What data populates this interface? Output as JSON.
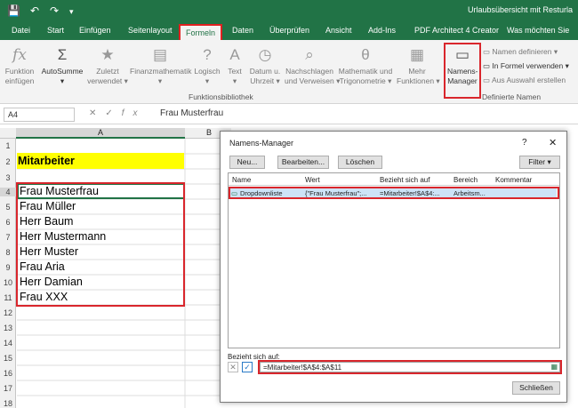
{
  "app": {
    "title": "Urlaubsübersicht mit Resturla",
    "qat": {
      "save": "💾",
      "undo": "↶",
      "redo": "↷",
      "customize": "▾"
    }
  },
  "tabs": [
    "Datei",
    "Start",
    "Einfügen",
    "Seitenlayout",
    "Formeln",
    "Daten",
    "Überprüfen",
    "Ansicht",
    "Add-Ins",
    "PDF Architect 4 Creator",
    "Was möchten Sie"
  ],
  "ribbon": {
    "buttons": [
      {
        "l1": "Funktion",
        "l2": "einfügen"
      },
      {
        "l1": "AutoSumme",
        "l2": "▾"
      },
      {
        "l1": "Zuletzt",
        "l2": "verwendet ▾"
      },
      {
        "l1": "Finanzmathematik",
        "l2": "▾"
      },
      {
        "l1": "Logisch",
        "l2": "▾"
      },
      {
        "l1": "Text",
        "l2": "▾"
      },
      {
        "l1": "Datum u.",
        "l2": "Uhrzeit ▾"
      },
      {
        "l1": "Nachschlagen",
        "l2": "und Verweisen ▾"
      },
      {
        "l1": "Mathematik und",
        "l2": "Trigonometrie ▾"
      },
      {
        "l1": "Mehr",
        "l2": "Funktionen ▾"
      },
      {
        "l1": "Namens-",
        "l2": "Manager"
      }
    ],
    "group_function_library": "Funktionsbibliothek",
    "names_menu": [
      "Namen definieren ▾",
      "In Formel verwenden ▾",
      "Aus Auswahl erstellen"
    ],
    "group_defined_names": "Definierte Namen"
  },
  "formula_bar": {
    "name_box": "A4",
    "cancel": "✕",
    "confirm": "✓",
    "fx": "fx",
    "content": "Frau Musterfrau"
  },
  "columns": [
    "A",
    "B"
  ],
  "rows": [
    "1",
    "2",
    "3",
    "4",
    "5",
    "6",
    "7",
    "8",
    "9",
    "10",
    "11",
    "12",
    "13",
    "14",
    "15",
    "16",
    "17",
    "18"
  ],
  "cells": {
    "a2": "Mitarbeiter",
    "a4": "Frau Musterfrau",
    "a5": "Frau Müller",
    "a6": "Herr Baum",
    "a7": "Herr Mustermann",
    "a8": "Herr Muster",
    "a9": "Frau Aria",
    "a10": "Herr Damian",
    "a11": "Frau XXX"
  },
  "dialog": {
    "title": "Namens-Manager",
    "help": "?",
    "close": "✕",
    "buttons": {
      "new": "Neu...",
      "edit": "Bearbeiten...",
      "delete": "Löschen",
      "filter": "Filter ▾",
      "close": "Schließen"
    },
    "columns": [
      "Name",
      "Wert",
      "Bezieht sich auf",
      "Bereich",
      "Kommentar"
    ],
    "row": {
      "name": "Dropdownliste",
      "value": "{\"Frau Musterfrau\";...",
      "refers_to": "=Mitarbeiter!$A$4:...",
      "scope": "Arbeitsm...",
      "comment": ""
    },
    "refers_label": "Bezieht sich auf:",
    "refers_value": "=Mitarbeiter!$A$4:$A$11"
  },
  "colors": {
    "excel_green": "#217346",
    "highlight_yellow": "#ffff00",
    "callout_red": "#d9262c"
  }
}
